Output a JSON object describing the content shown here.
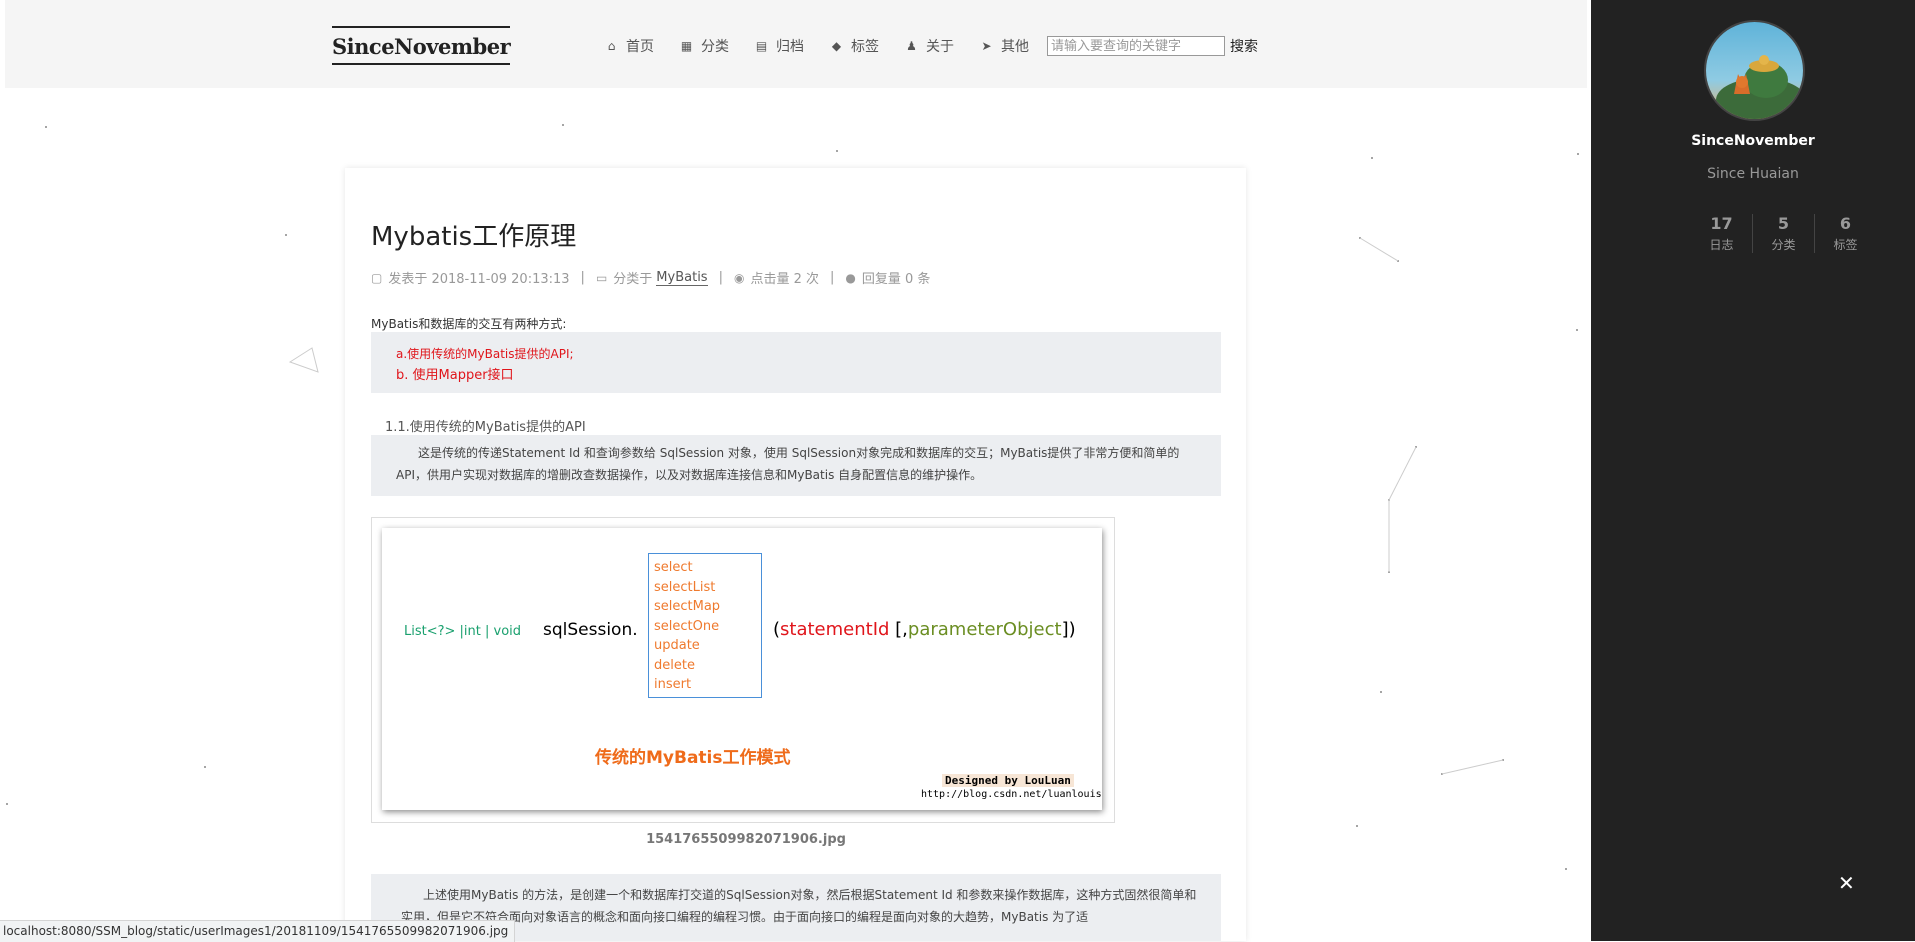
{
  "header": {
    "logo": "SinceNovember",
    "nav": [
      {
        "label": "首页",
        "icon": "home-icon"
      },
      {
        "label": "分类",
        "icon": "th-icon"
      },
      {
        "label": "归档",
        "icon": "archive-icon"
      },
      {
        "label": "标签",
        "icon": "tags-icon"
      },
      {
        "label": "关于",
        "icon": "user-icon"
      },
      {
        "label": "其他",
        "icon": "paper-plane-icon"
      }
    ],
    "search_placeholder": "请输入要查询的关键字",
    "search_label": "搜索"
  },
  "post": {
    "title": "Mybatis工作原理",
    "meta": {
      "published": "发表于 2018-11-09 20:13:13",
      "category_prefix": "分类于",
      "category": "MyBatis",
      "views": "点击量 2 次",
      "comments": "回复量 0 条"
    },
    "intro": "MyBatis和数据库的交互有两种方式:",
    "methods": [
      "a.使用传统的MyBatis提供的API;",
      "b. 使用Mapper接口"
    ],
    "section_title": "1.1.使用传统的MyBatis提供的API",
    "section_text": "这是传统的传递Statement Id 和查询参数给 SqlSession 对象，使用 SqlSession对象完成和数据库的交互；MyBatis提供了非常方便和简单的API，供用户实现对数据库的增删改查数据操作，以及对数据库连接信息和MyBatis 自身配置信息的维护操作。",
    "diagram": {
      "return_types": "List<?> |int | void",
      "receiver": "sqlSession.",
      "methods": [
        "select",
        "selectList",
        "selectMap",
        "selectOne",
        "update",
        "delete",
        "insert"
      ],
      "open_paren": "(",
      "statement_id": "statementId",
      "bracket": " [,",
      "parameter": "parameterObject",
      "close": "])",
      "caption": "传统的MyBatis工作模式",
      "designed_by": "Designed by LouLuan",
      "url": "http://blog.csdn.net/luanlouis"
    },
    "image_filename": "1541765509982071906.jpg",
    "paragraph2": "上述使用MyBatis 的方法，是创建一个和数据库打交道的SqlSession对象，然后根据Statement Id 和参数来操作数据库，这种方式固然很简单和实用，但是它不符合面向对象语言的概念和面向接口编程的编程习惯。由于面向接口的编程是面向对象的大趋势，MyBatis 为了适"
  },
  "status_url": "localhost:8080/SSM_blog/static/userImages1/20181109/1541765509982071906.jpg",
  "sidebar": {
    "name": "SinceNovember",
    "description": "Since Huaian",
    "stats": [
      {
        "count": "17",
        "label": "日志"
      },
      {
        "count": "5",
        "label": "分类"
      },
      {
        "count": "6",
        "label": "标签"
      }
    ],
    "close_icon": "close-icon"
  }
}
